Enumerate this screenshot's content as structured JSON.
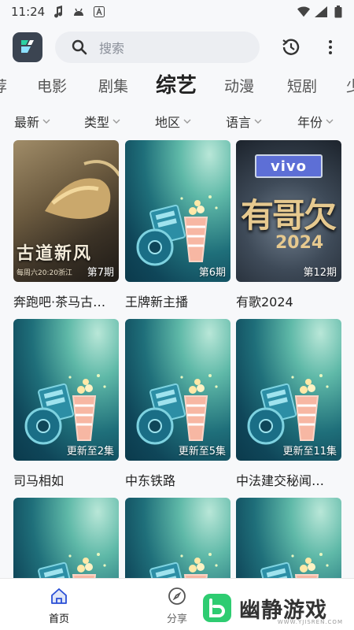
{
  "status_bar": {
    "time": "11:24"
  },
  "search": {
    "placeholder": "搜索"
  },
  "category_tabs": [
    "荐",
    "电影",
    "剧集",
    "综艺",
    "动漫",
    "短剧",
    "少"
  ],
  "active_category": "综艺",
  "filters": [
    "最新",
    "类型",
    "地区",
    "语言",
    "年份"
  ],
  "items": [
    {
      "title": "奔跑吧·茶马古…",
      "badge": "第7期",
      "poster": "ben"
    },
    {
      "title": "王牌新主播",
      "badge": "第6期",
      "poster": "placeholder"
    },
    {
      "title": "有歌2024",
      "badge": "第12期",
      "poster": "you"
    },
    {
      "title": "司马相如",
      "badge": "更新至2集",
      "poster": "placeholder"
    },
    {
      "title": "中东铁路",
      "badge": "更新至5集",
      "poster": "placeholder"
    },
    {
      "title": "中法建交秘闻…",
      "badge": "更新至11集",
      "poster": "placeholder"
    },
    {
      "title": "",
      "badge": "",
      "poster": "placeholder"
    },
    {
      "title": "",
      "badge": "",
      "poster": "placeholder"
    },
    {
      "title": "",
      "badge": "",
      "poster": "placeholder"
    }
  ],
  "poster_text": {
    "ben_title": "古道新风",
    "ben_sub": "每周六20:20浙江",
    "you_brand": "vivo",
    "you_title": "有哥欠",
    "you_year": "2024"
  },
  "bottom_nav": [
    {
      "label": "首页",
      "icon": "home-icon",
      "active": true
    },
    {
      "label": "分享",
      "icon": "compass-icon",
      "active": false
    }
  ],
  "watermark": {
    "text": "幽静游戏",
    "url": "WWW.YJISREN.COM"
  },
  "colors": {
    "accent": "#2a4fd6",
    "text": "#222222",
    "placeholder_teal": "#1f6f7a"
  }
}
